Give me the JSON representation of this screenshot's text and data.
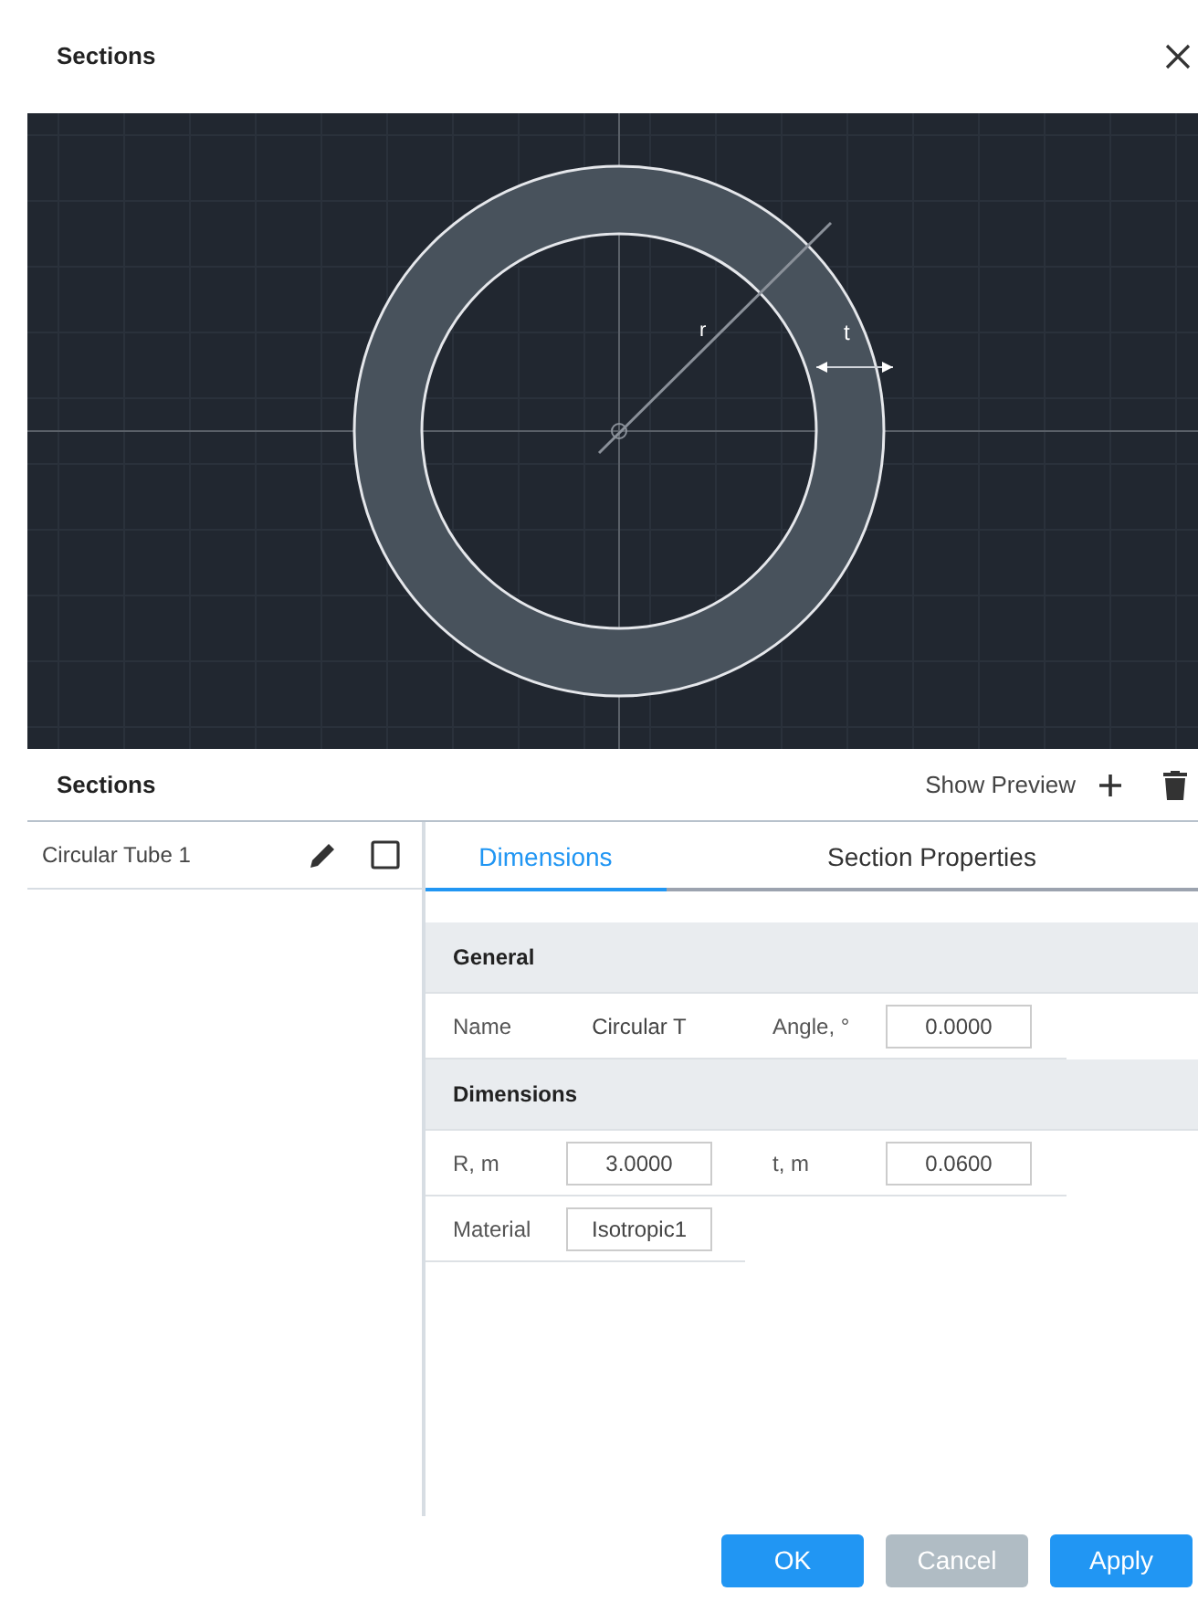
{
  "window": {
    "title": "Sections"
  },
  "preview": {
    "r_label": "r",
    "t_label": "t"
  },
  "toolbar": {
    "title": "Sections",
    "show_preview": "Show Preview"
  },
  "sections": [
    {
      "name": "Circular Tube 1",
      "selected": false
    }
  ],
  "tabs": [
    {
      "label": "Dimensions",
      "selected": true
    },
    {
      "label": "Section Properties",
      "selected": false
    }
  ],
  "groups": [
    {
      "title": "General",
      "rows": [
        [
          {
            "label": "Name",
            "value": "Circular T",
            "kind": "text"
          },
          {
            "label": "Angle, °",
            "value": "0.0000",
            "kind": "input"
          }
        ]
      ]
    },
    {
      "title": "Dimensions",
      "rows": [
        [
          {
            "label": "R, m",
            "value": "3.0000",
            "kind": "input"
          },
          {
            "label": "t, m",
            "value": "0.0600",
            "kind": "input"
          }
        ],
        [
          {
            "label": "Material",
            "value": "Isotropic1",
            "kind": "input"
          }
        ]
      ]
    }
  ],
  "buttons": [
    {
      "label": "OK",
      "disabled": false
    },
    {
      "label": "Cancel",
      "disabled": true
    },
    {
      "label": "Apply",
      "disabled": false
    }
  ]
}
